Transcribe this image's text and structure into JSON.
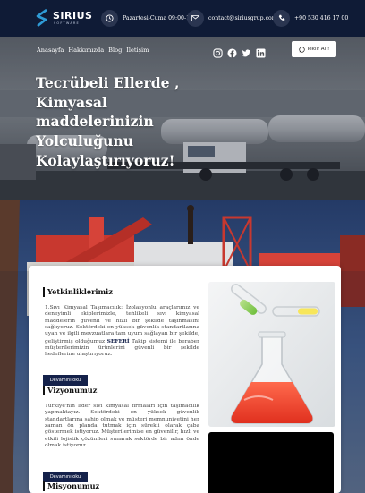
{
  "topbar": {
    "logo_name": "SIRIUS",
    "logo_sub": "SOFTWARE",
    "hours": "Pazartesi-Cuma 09:00-18:00",
    "email": "contact@siriusgrup.com",
    "phone": "+90 530 416 17 00"
  },
  "nav": {
    "items": [
      "Anasayfa",
      "Hakkımızda",
      "Blog",
      "İletişim"
    ],
    "social_icons": [
      "instagram-icon",
      "facebook-icon",
      "twitter-icon",
      "linkedin-icon"
    ],
    "quote_button": "Teklif Al !"
  },
  "hero": {
    "title_lines": [
      "Tecrübeli Ellerde ,",
      "Kimyasal",
      "maddelerinizin",
      "Yolculuğunu",
      "Kolaylaştırıyoruz!"
    ]
  },
  "sections": {
    "competencies": {
      "title": "Yetkinliklerimiz",
      "text_before": "1.Sıvı Kimyasal Taşımacılık: İzolasyonlu araçlarımız ve deneyimli ekiplerimizle, tehlikeli sıvı kimyasal maddelerin güvenli ve hızlı bir şekilde taşınmasını sağlıyoruz. Sektördeki en yüksek güvenlik standartlarına uyan ve ilgili mevzuatlara tam uyum sağlayan bir şekilde, geliştirmiş olduğumuz ",
      "highlight": "SEFERİ",
      "text_after": " Takip sistemi ile beraber müşterilerimizin ürünlerini güvenli bir şekilde hedeflerine ulaştırıyoruz.",
      "button": "Devamını oku"
    },
    "vision": {
      "title": "Vizyonumuz",
      "text": "Türkiye'nin lider sıvı kimyasal firmaları için taşımacılık yapmaktayız. Sektördeki en yüksek güvenlik standartlarına sahip olmak ve müşteri memnuniyetini her zaman ön planda tutmak için sürekli olarak çaba göstermek istiyoruz. Müşterilerimize en güvenilir, hızlı ve etkili lojistik çözümleri sunarak sektörde bir adım önde olmak istiyoruz.",
      "button": "Devamını oku"
    },
    "mission": {
      "title": "Misyonumuz"
    }
  },
  "colors": {
    "navy": "#0f1b36",
    "button": "#14214a",
    "accent": "#1e88c9"
  }
}
